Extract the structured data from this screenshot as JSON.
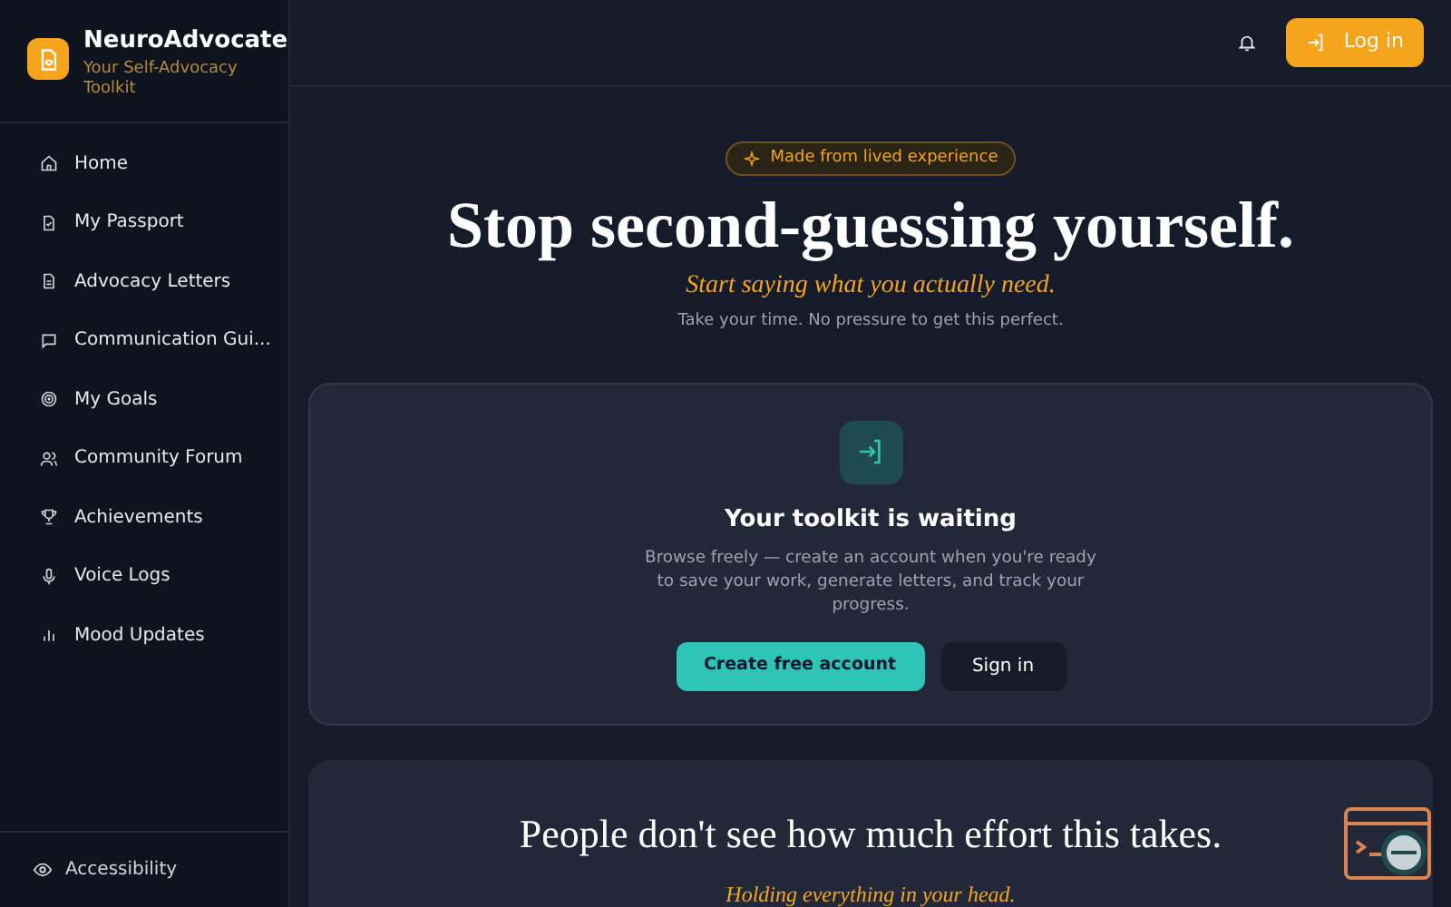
{
  "app": {
    "name": "NeuroAdvocate",
    "tagline": "Your Self-Advocacy Toolkit"
  },
  "sidebar": {
    "items": [
      {
        "label": "Home",
        "selected": false
      },
      {
        "label": "My Passport",
        "selected": false
      },
      {
        "label": "Advocacy Letters",
        "selected": false
      },
      {
        "label": "Communication Gui...",
        "selected": false
      },
      {
        "label": "My Goals",
        "selected": false
      },
      {
        "label": "Community Forum",
        "selected": false
      },
      {
        "label": "Achievements",
        "selected": false
      },
      {
        "label": "Voice Logs",
        "selected": false
      },
      {
        "label": "Mood Updates",
        "selected": false
      }
    ],
    "footer": {
      "label": "Accessibility"
    }
  },
  "header": {
    "login_button": "Log in"
  },
  "hero": {
    "badge": "Made from lived experience",
    "title": "Stop second-guessing yourself.",
    "subtitle": "Start saying what you actually need.",
    "note": "Take your time. No pressure to get this perfect."
  },
  "toolkit_card": {
    "title": "Your toolkit is waiting",
    "text": "Browse freely — create an account when you're ready to save your work, generate letters, and track your progress.",
    "primary_button": "Create free account",
    "secondary_button": "Sign in"
  },
  "effort_card": {
    "title": "People don't see how much effort this takes.",
    "subtitle": "Holding everything in your head."
  }
}
